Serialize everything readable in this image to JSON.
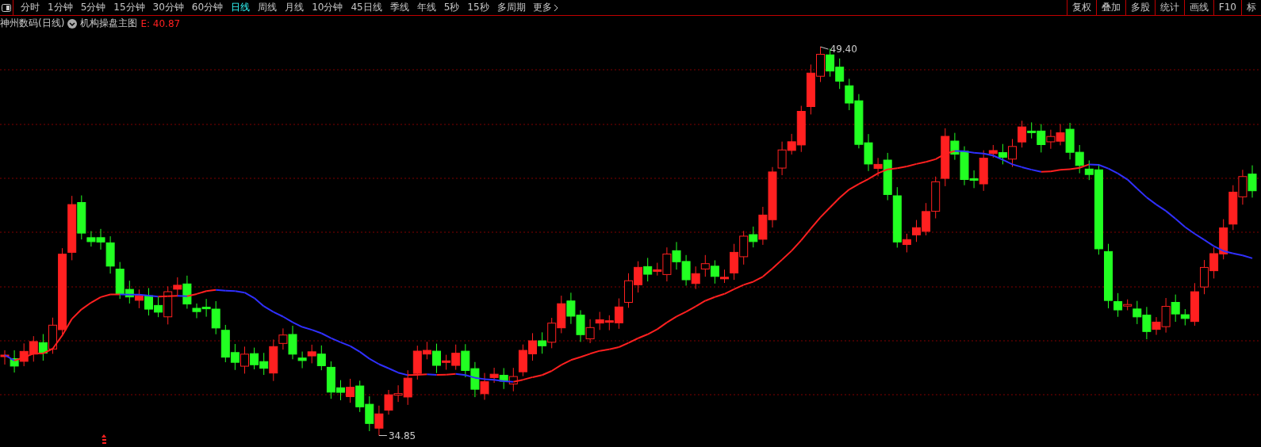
{
  "toolbar": {
    "periods": [
      {
        "label": "分时",
        "selected": false
      },
      {
        "label": "1分钟",
        "selected": false
      },
      {
        "label": "5分钟",
        "selected": false
      },
      {
        "label": "15分钟",
        "selected": false
      },
      {
        "label": "30分钟",
        "selected": false
      },
      {
        "label": "60分钟",
        "selected": false
      },
      {
        "label": "日线",
        "selected": true
      },
      {
        "label": "周线",
        "selected": false
      },
      {
        "label": "月线",
        "selected": false
      },
      {
        "label": "10分钟",
        "selected": false
      },
      {
        "label": "45日线",
        "selected": false
      },
      {
        "label": "季线",
        "selected": false
      },
      {
        "label": "年线",
        "selected": false
      },
      {
        "label": "5秒",
        "selected": false
      },
      {
        "label": "15秒",
        "selected": false
      },
      {
        "label": "多周期",
        "selected": false
      }
    ],
    "more": "更多",
    "tools": [
      "复权",
      "叠加",
      "多股",
      "统计",
      "画线",
      "F10",
      "标"
    ]
  },
  "header": {
    "stock": "神州数码(日线)",
    "indicator": "机构操盘主图",
    "value": "E: 40.87"
  },
  "chart": {
    "high_label": "49.40",
    "low_label": "34.85"
  }
}
